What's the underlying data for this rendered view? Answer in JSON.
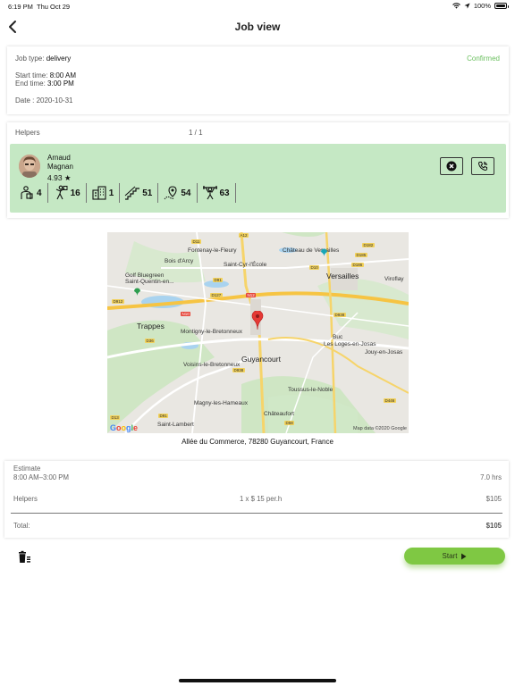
{
  "status_bar": {
    "time": "6:19 PM",
    "date": "Thu Oct 29",
    "battery": "100%",
    "battery_level": 1.0
  },
  "nav": {
    "title": "Job view",
    "back_icon": "chevron-left-icon"
  },
  "job": {
    "type_label": "Job type:",
    "type_value": "delivery",
    "status": "Confirmed",
    "start_label": "Start time:",
    "start_value": "8:00 AM",
    "end_label": "End time:",
    "end_value": "3:00 PM",
    "date": "Date : 2020-10-31"
  },
  "helpers": {
    "label": "Helpers",
    "count": "1 / 1",
    "items": [
      {
        "first_name": "Arnaud",
        "last_name": "Magnan",
        "rating": "4.93",
        "stats": [
          {
            "icon": "delivery-person-icon",
            "value": "4"
          },
          {
            "icon": "mover-icon",
            "value": "16"
          },
          {
            "icon": "building-icon",
            "value": "1"
          },
          {
            "icon": "stairs-icon",
            "value": "51"
          },
          {
            "icon": "location-pin-icon",
            "value": "54"
          },
          {
            "icon": "weightlifter-icon",
            "value": "63"
          }
        ]
      }
    ]
  },
  "map": {
    "labels": [
      "Fontenay-le-Fleury",
      "Château de Versailles",
      "Bois d'Arcy",
      "Saint-Cyr-l'École",
      "Versailles",
      "Viroflay",
      "Golf Bluegreen Saint-Quentin-en...",
      "Trappes",
      "Montigny-le-Bretonneux",
      "Buc",
      "Les Loges-en-Josas",
      "Jouy-en-Josas",
      "Guyancourt",
      "Voisins-le-Bretonneux",
      "Toussus-le-Noble",
      "Magny-les-Hameaux",
      "Châteaufort",
      "Saint-Lambert"
    ],
    "road_tags": [
      "A12",
      "D11",
      "D10",
      "D185",
      "D186",
      "D182",
      "D91",
      "D127",
      "N12",
      "D912",
      "N10",
      "D36",
      "D938",
      "D446",
      "D58",
      "D91",
      "D13",
      "D938"
    ],
    "attribution": "Map data ©2020 Google",
    "logo": "Google",
    "address": "Allée du Commerce, 78280 Guyancourt, France"
  },
  "estimate": {
    "label": "Estimate",
    "time_range": "8:00 AM–3:00 PM",
    "duration": "7.0 hrs",
    "helpers_label": "Helpers",
    "helpers_rate": "1 x $ 15 per.h",
    "helpers_cost": "$105",
    "total_label": "Total:",
    "total_value": "$105"
  },
  "actions": {
    "delete_icon": "trash-list-icon",
    "start_label": "Start",
    "start_icon": "play-icon"
  },
  "colors": {
    "accent_green": "#7fc843",
    "helper_bg": "#c5e8c4",
    "confirmed": "#6abf5e"
  }
}
